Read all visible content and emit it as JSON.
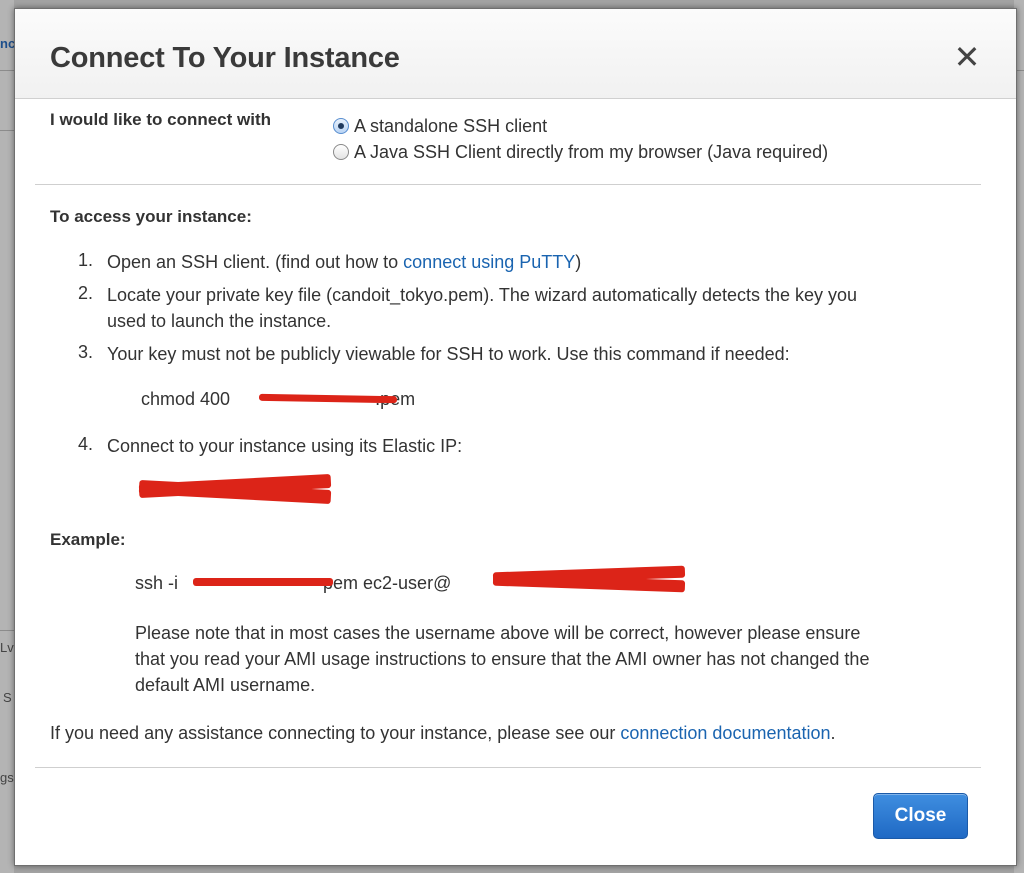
{
  "background": {
    "left_fragments": [
      "nc",
      "Lv",
      "S",
      "gs"
    ]
  },
  "dialog": {
    "title": "Connect To Your Instance",
    "close_glyph": "✕",
    "connect_with": {
      "label": "I would like to connect with",
      "options": [
        {
          "label": "A standalone SSH client",
          "checked": true
        },
        {
          "label": "A Java SSH Client directly from my browser (Java required)",
          "checked": false
        }
      ]
    },
    "access": {
      "heading": "To access your instance:",
      "steps": [
        {
          "num": "1.",
          "text_before": "Open an SSH client. (find out how to ",
          "link": "connect using PuTTY",
          "text_after": ")"
        },
        {
          "num": "2.",
          "line1": "Locate your private key file (candoit_tokyo.pem). The wizard automatically detects the key you",
          "line2": "used to launch the instance."
        },
        {
          "num": "3.",
          "text": "Your key must not be publicly viewable for SSH to work. Use this command if needed:"
        },
        {
          "num": "4.",
          "text": "Connect to your instance using its Elastic IP:"
        }
      ],
      "chmod_command_prefix": "chmod 400 ",
      "chmod_command_suffix": ".pem"
    },
    "example": {
      "heading": "Example:",
      "ssh_prefix": "ssh -i ",
      "ssh_middle": "pem ec2-user@",
      "note_lines": [
        "Please note that in most cases the username above will be correct, however please ensure",
        "that you read your AMI usage instructions to ensure that the AMI owner has not changed the",
        "default AMI username."
      ]
    },
    "assistance": {
      "text_before": "If you need any assistance connecting to your instance, please see our ",
      "link": "connection documentation",
      "text_after": "."
    },
    "close_button": "Close"
  }
}
